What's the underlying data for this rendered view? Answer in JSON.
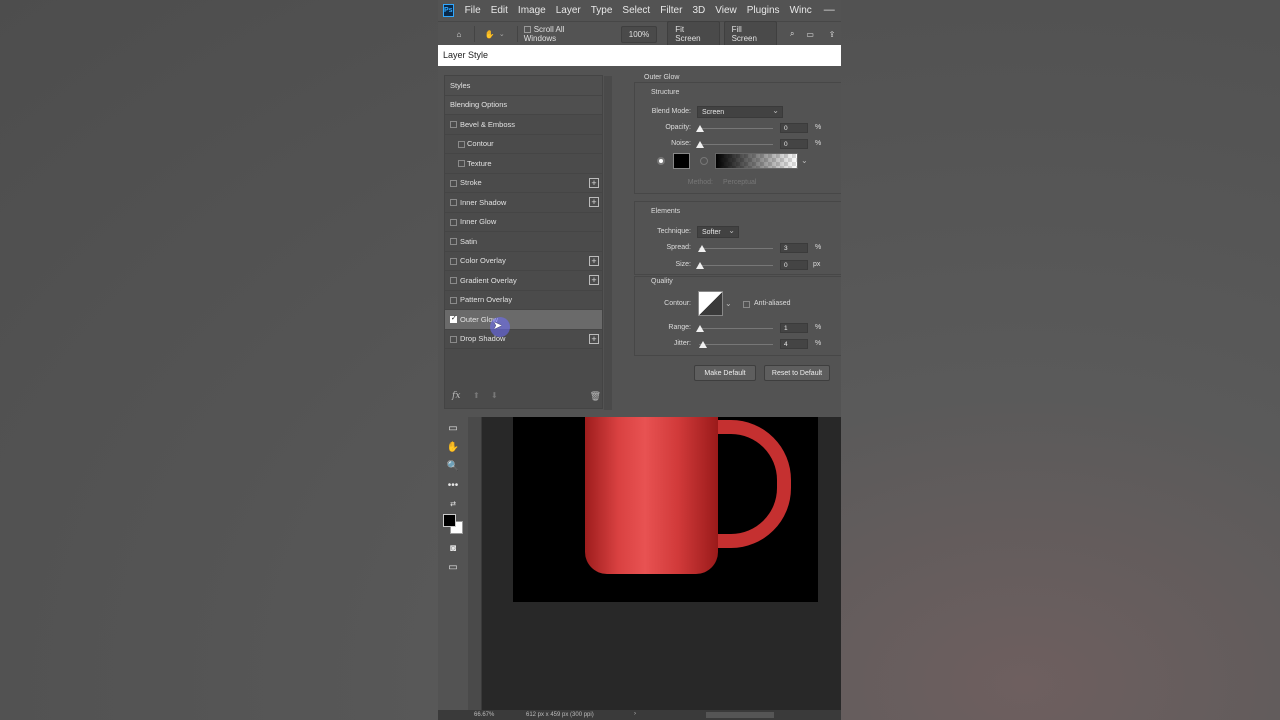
{
  "menubar": {
    "logo": "Ps",
    "items": [
      "File",
      "Edit",
      "Image",
      "Layer",
      "Type",
      "Select",
      "Filter",
      "3D",
      "View",
      "Plugins",
      "Winc"
    ]
  },
  "optionsbar": {
    "scroll_all_label": "Scroll All Windows",
    "zoom_value": "100%",
    "fit_screen": "Fit Screen",
    "fill_screen": "Fill Screen"
  },
  "dialog": {
    "title": "Layer Style",
    "styles_header": "Styles",
    "items": [
      {
        "label": "Blending Options",
        "kind": "plain"
      },
      {
        "label": "Bevel & Emboss",
        "kind": "check"
      },
      {
        "label": "Contour",
        "kind": "sub"
      },
      {
        "label": "Texture",
        "kind": "sub"
      },
      {
        "label": "Stroke",
        "kind": "check",
        "plus": true
      },
      {
        "label": "Inner Shadow",
        "kind": "check",
        "plus": true
      },
      {
        "label": "Inner Glow",
        "kind": "check"
      },
      {
        "label": "Satin",
        "kind": "check"
      },
      {
        "label": "Color Overlay",
        "kind": "check",
        "plus": true
      },
      {
        "label": "Gradient Overlay",
        "kind": "check",
        "plus": true
      },
      {
        "label": "Pattern Overlay",
        "kind": "check"
      },
      {
        "label": "Outer Glow",
        "kind": "check",
        "checked": true,
        "active": true
      },
      {
        "label": "Drop Shadow",
        "kind": "check",
        "plus": true
      }
    ],
    "fx_label": "fx"
  },
  "outer_glow": {
    "title": "Outer Glow",
    "structure": {
      "title": "Structure",
      "blend_mode_label": "Blend Mode:",
      "blend_mode_value": "Screen",
      "opacity_label": "Opacity:",
      "opacity_value": "0",
      "opacity_unit": "%",
      "noise_label": "Noise:",
      "noise_value": "0",
      "noise_unit": "%",
      "glow_color": "#000000",
      "method_label": "Method:",
      "method_value": "Perceptual"
    },
    "elements": {
      "title": "Elements",
      "technique_label": "Technique:",
      "technique_value": "Softer",
      "spread_label": "Spread:",
      "spread_value": "3",
      "spread_unit": "%",
      "size_label": "Size:",
      "size_value": "0",
      "size_unit": "px"
    },
    "quality": {
      "title": "Quality",
      "contour_label": "Contour:",
      "anti_aliased_label": "Anti-aliased",
      "range_label": "Range:",
      "range_value": "1",
      "range_unit": "%",
      "jitter_label": "Jitter:",
      "jitter_value": "4",
      "jitter_unit": "%"
    },
    "make_default": "Make Default",
    "reset_default": "Reset to Default"
  },
  "status": {
    "zoom": "66.67%",
    "doc_info": "612 px x 459 px (300 ppi)"
  },
  "colors": {
    "accent": "#31a8ff",
    "mug": "#d94141"
  }
}
